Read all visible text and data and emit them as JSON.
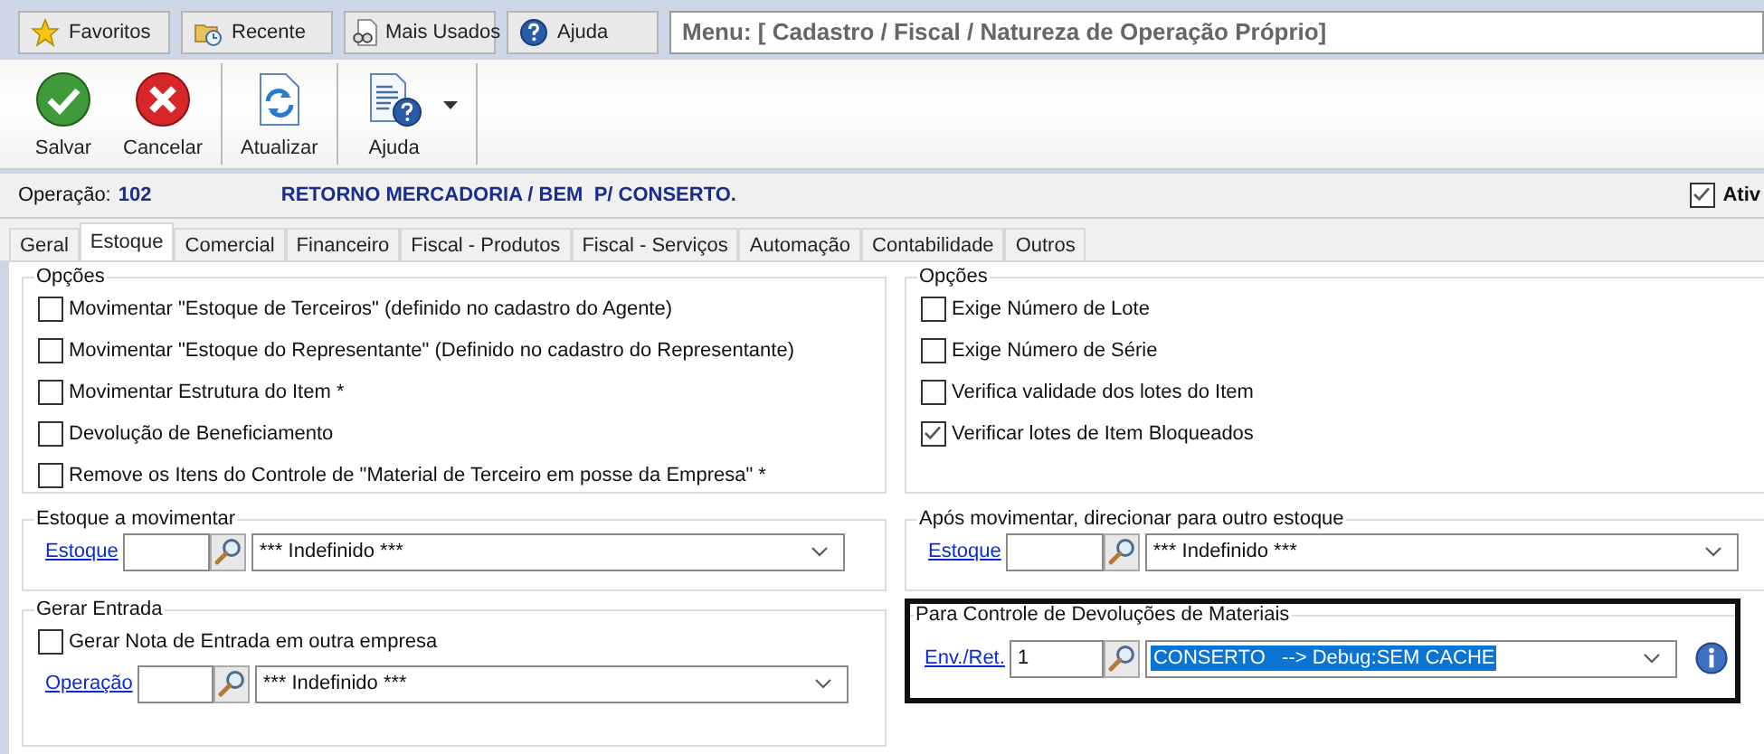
{
  "nav_buttons": [
    {
      "label": "Favoritos"
    },
    {
      "label": "Recente"
    },
    {
      "label": "Mais Usados"
    },
    {
      "label": "Ajuda"
    }
  ],
  "menu_path": "Menu: [ Cadastro / Fiscal / Natureza de Operação Próprio]",
  "toolbar": [
    {
      "label": "Salvar",
      "separator_after": false,
      "dropdown": false
    },
    {
      "label": "Cancelar",
      "separator_after": true,
      "dropdown": false
    },
    {
      "label": "Atualizar",
      "separator_after": true,
      "dropdown": false
    },
    {
      "label": "Ajuda",
      "separator_after": true,
      "dropdown": true
    }
  ],
  "operation": {
    "label": "Operação:",
    "code": "102",
    "description": "RETORNO MERCADORIA / BEM  P/ CONSERTO."
  },
  "active_checkbox": {
    "label": "Ativ",
    "checked": true
  },
  "tabs": [
    {
      "label": "Geral",
      "selected": false
    },
    {
      "label": "Estoque",
      "selected": true
    },
    {
      "label": "Comercial",
      "selected": false
    },
    {
      "label": "Financeiro",
      "selected": false
    },
    {
      "label": "Fiscal - Produtos",
      "selected": false
    },
    {
      "label": "Fiscal - Serviços",
      "selected": false
    },
    {
      "label": "Automação",
      "selected": false
    },
    {
      "label": "Contabilidade",
      "selected": false
    },
    {
      "label": "Outros",
      "selected": false
    }
  ],
  "left_options": {
    "title": "Opções",
    "items": [
      {
        "label": "Movimentar \"Estoque de Terceiros\" (definido no cadastro do Agente)",
        "checked": false
      },
      {
        "label": "Movimentar \"Estoque do Representante\" (Definido no cadastro do Representante)",
        "checked": false
      },
      {
        "label": "Movimentar Estrutura do Item *",
        "checked": false
      },
      {
        "label": "Devolução de Beneficiamento",
        "checked": false
      },
      {
        "label": "Remove os Itens do Controle de \"Material de Terceiro em posse da Empresa\" *",
        "checked": false
      }
    ]
  },
  "right_options": {
    "title": "Opções",
    "items": [
      {
        "label": "Exige Número de Lote",
        "checked": false
      },
      {
        "label": "Exige Número de Série",
        "checked": false
      },
      {
        "label": "Verifica validade dos lotes do Item",
        "checked": false
      },
      {
        "label": "Verificar lotes de Item Bloqueados",
        "checked": true
      }
    ]
  },
  "estoque_movimentar": {
    "title": "Estoque a movimentar",
    "link": "Estoque",
    "value": "*** Indefinido ***"
  },
  "gerar_entrada": {
    "title": "Gerar Entrada",
    "checkbox": {
      "label": "Gerar Nota de Entrada em outra empresa",
      "checked": false
    },
    "link": "Operação",
    "value": "*** Indefinido ***"
  },
  "apos_movimentar": {
    "title": "Após movimentar, direcionar para outro estoque",
    "link": "Estoque",
    "value": "*** Indefinido ***"
  },
  "devolucoes": {
    "title": "Para Controle de Devoluções de Materiais",
    "link": "Env./Ret.",
    "code": "1",
    "value": "CONSERTO   --> Debug:SEM CACHE",
    "selected": true
  }
}
